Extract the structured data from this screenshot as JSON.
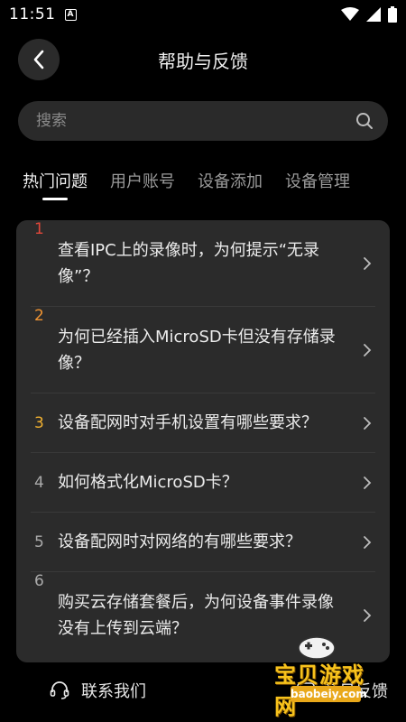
{
  "status_bar": {
    "time": "11:51",
    "indicator": "A"
  },
  "header": {
    "title": "帮助与反馈",
    "back_icon": "chevron-left-icon"
  },
  "search": {
    "placeholder": "搜索",
    "value": "",
    "icon": "search-icon"
  },
  "tabs": [
    {
      "label": "热门问题",
      "active": true
    },
    {
      "label": "用户账号",
      "active": false
    },
    {
      "label": "设备添加",
      "active": false
    },
    {
      "label": "设备管理",
      "active": false
    }
  ],
  "faq": {
    "items": [
      {
        "num": "1",
        "text": "查看IPC上的录像时，为何提示“无录像”？",
        "num_color": "#e0473a"
      },
      {
        "num": "2",
        "text": "为何已经插入MicroSD卡但没有存储录像？",
        "num_color": "#f09432"
      },
      {
        "num": "3",
        "text": "设备配网时对手机设置有哪些要求？",
        "num_color": "#f0b030"
      },
      {
        "num": "4",
        "text": "如何格式化MicroSD卡？",
        "num_color": "#aaaaaa"
      },
      {
        "num": "5",
        "text": "设备配网时对网络的有哪些要求？",
        "num_color": "#aaaaaa"
      },
      {
        "num": "6",
        "text": "购买云存储套餐后，为何设备事件录像没有上传到云端？",
        "num_color": "#aaaaaa"
      }
    ]
  },
  "bottom": {
    "contact_label": "联系我们",
    "feedback_label": "意见反馈",
    "contact_icon": "headset-icon",
    "feedback_icon": "feedback-icon"
  },
  "watermark": {
    "text": "宝贝游戏网",
    "url": "baobeiy.com"
  },
  "colors": {
    "background": "#000000",
    "card": "#2b2b2b",
    "accent_red": "#e0473a",
    "accent_orange": "#f09432",
    "accent_yellow": "#f0b030"
  }
}
